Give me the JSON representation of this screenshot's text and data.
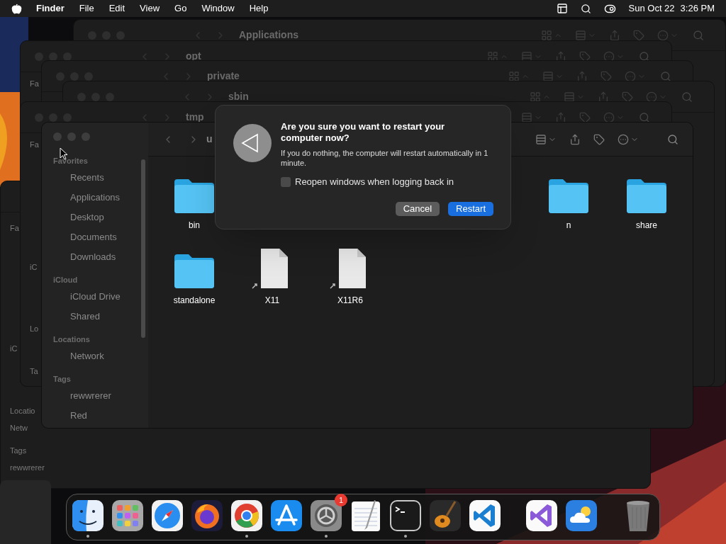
{
  "menu_bar": {
    "app": "Finder",
    "menus": [
      "File",
      "Edit",
      "View",
      "Go",
      "Window",
      "Help"
    ],
    "date": "Sun Oct 22",
    "time": "3:26 PM"
  },
  "back_windows": [
    {
      "title": "Applications"
    },
    {
      "title": "opt",
      "sidebar": [
        "Fa"
      ]
    },
    {
      "title": "private"
    },
    {
      "title": "sbin"
    },
    {
      "title": "tmp",
      "sidebar": [
        "Fa",
        "iC",
        "Lo",
        "Ta"
      ]
    },
    {
      "sidebar": [
        "Fa",
        "iC",
        "Locatio",
        "Netw",
        "Tags",
        "rewwrerer"
      ]
    }
  ],
  "window": {
    "title": "u",
    "sidebar": [
      {
        "heading": "Favorites",
        "items": [
          "Recents",
          "Applications",
          "Desktop",
          "Documents",
          "Downloads"
        ]
      },
      {
        "heading": "iCloud",
        "items": [
          "iCloud Drive",
          "Shared"
        ]
      },
      {
        "heading": "Locations",
        "items": [
          "Network"
        ]
      },
      {
        "heading": "Tags",
        "items": [
          "rewwrerer",
          "Red"
        ]
      }
    ],
    "rows": [
      [
        {
          "name": "bin",
          "kind": "folder"
        },
        {
          "name": "n",
          "kind": "folder"
        },
        {
          "name": "share",
          "kind": "folder"
        }
      ],
      [
        {
          "name": "standalone",
          "kind": "folder"
        },
        {
          "name": "X11",
          "kind": "alias"
        },
        {
          "name": "X11R6",
          "kind": "alias"
        }
      ]
    ]
  },
  "dialog": {
    "title": "Are you sure you want to restart your computer now?",
    "message": "If you do nothing, the computer will restart automatically in 1 minute.",
    "checkbox": {
      "label": "Reopen windows when logging back in",
      "checked": false
    },
    "buttons": [
      {
        "label": "Cancel",
        "primary": false
      },
      {
        "label": "Restart",
        "primary": true
      }
    ]
  },
  "dock": [
    {
      "kind": "finder",
      "running": true
    },
    {
      "kind": "launchpad",
      "running": false
    },
    {
      "kind": "safari",
      "running": false
    },
    {
      "kind": "firefox",
      "running": false
    },
    {
      "kind": "chrome",
      "running": true
    },
    {
      "kind": "appstore",
      "running": false
    },
    {
      "kind": "settings",
      "running": true,
      "badge": "1"
    },
    {
      "kind": "textedit",
      "running": false
    },
    {
      "kind": "terminal",
      "running": true
    },
    {
      "kind": "garageband",
      "running": false
    },
    {
      "kind": "vscode",
      "running": false
    },
    {
      "kind": "separator"
    },
    {
      "kind": "visualstudio",
      "running": false
    },
    {
      "kind": "weather",
      "running": false
    },
    {
      "kind": "separator"
    },
    {
      "kind": "trash",
      "running": false
    }
  ]
}
